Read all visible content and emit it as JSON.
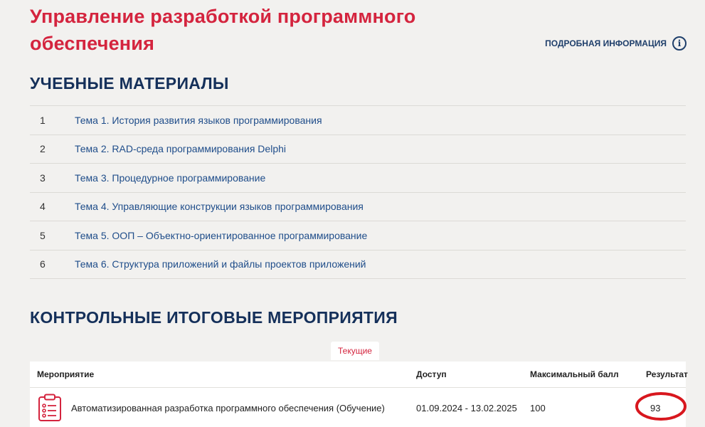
{
  "course": {
    "title": "Управление разработкой программного обеспечения",
    "info_link": "ПОДРОБНАЯ ИНФОРМАЦИЯ",
    "info_icon": "info-circle-icon"
  },
  "materials": {
    "heading": "УЧЕБНЫЕ МАТЕРИАЛЫ",
    "items": [
      {
        "num": "1",
        "label": "Тема 1. История развития языков программирования"
      },
      {
        "num": "2",
        "label": "Тема 2. RAD-среда программирования Delphi"
      },
      {
        "num": "3",
        "label": "Тема 3. Процедурное программирование"
      },
      {
        "num": "4",
        "label": "Тема 4. Управляющие конструкции языков программирования"
      },
      {
        "num": "5",
        "label": "Тема 5. ООП – Объектно-ориентированное программирование"
      },
      {
        "num": "6",
        "label": "Тема 6. Структура приложений и файлы проектов приложений"
      }
    ]
  },
  "events": {
    "heading": "КОНТРОЛЬНЫЕ ИТОГОВЫЕ МЕРОПРИЯТИЯ",
    "tab_current": "Текущие",
    "columns": {
      "event": "Мероприятие",
      "access": "Доступ",
      "max_score": "Максимальный балл",
      "result": "Результат"
    },
    "rows": [
      {
        "icon": "clipboard-checklist-icon",
        "name": "Автоматизированная разработка программного обеспечения (Обучение)",
        "access": "01.09.2024 - 13.02.2025",
        "max_score": "100",
        "result": "93"
      }
    ]
  },
  "colors": {
    "accent_red": "#d4243e",
    "heading_navy": "#15305a",
    "link_blue": "#1f4d8a",
    "background": "#f2f1ef"
  }
}
